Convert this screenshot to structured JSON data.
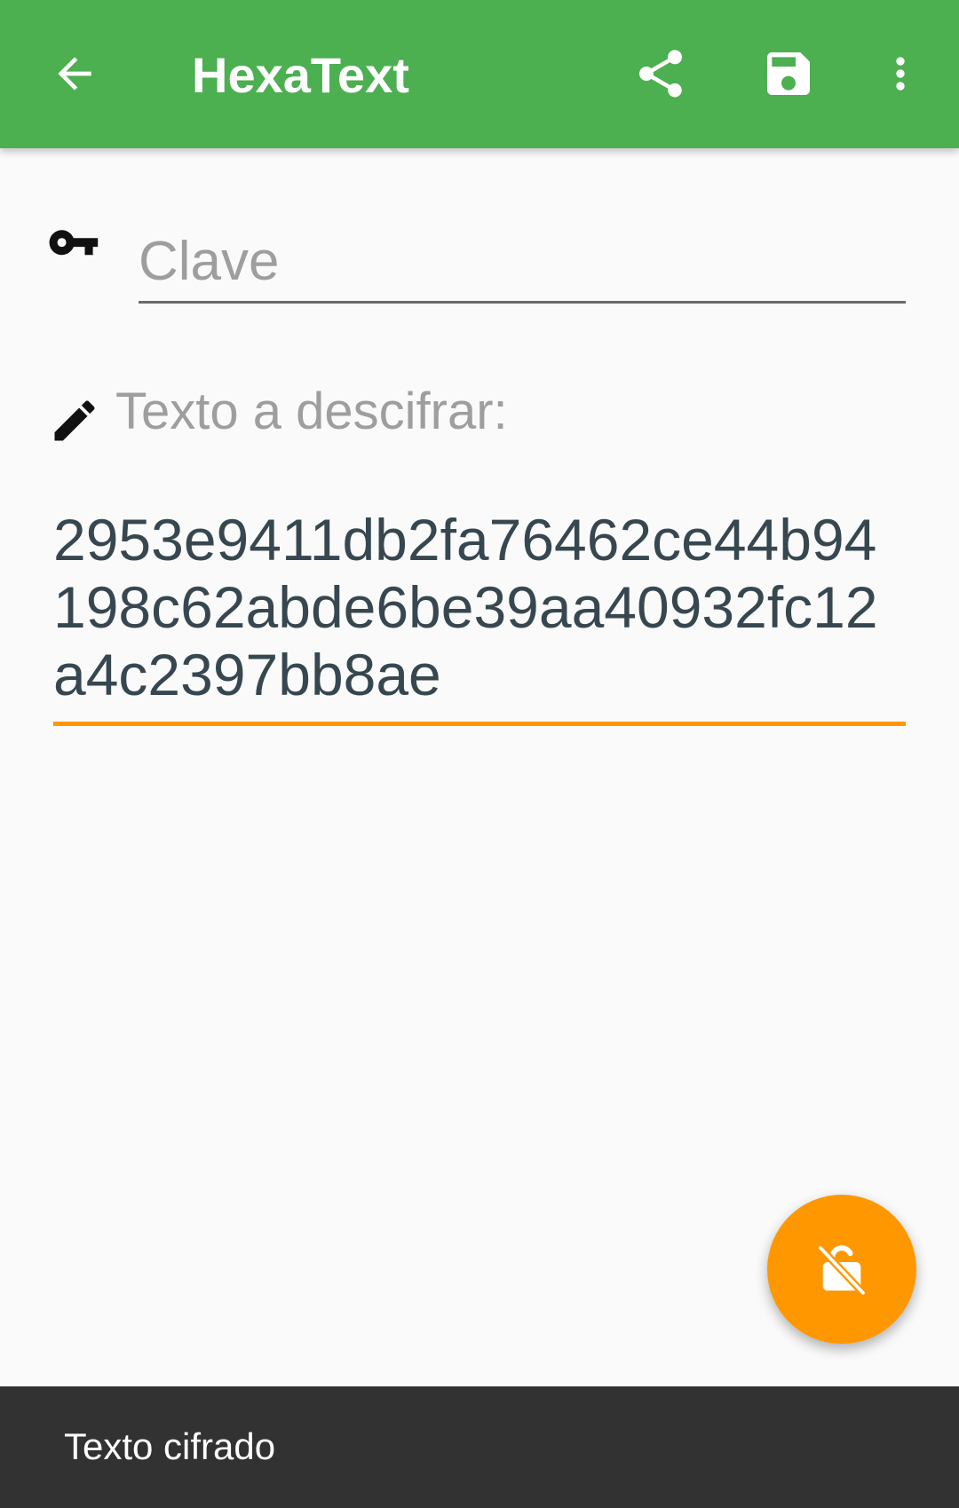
{
  "app_bar": {
    "title": "HexaText",
    "back_icon": "arrow-back-icon",
    "share_icon": "share-icon",
    "save_icon": "save-icon",
    "more_icon": "more-vert-icon",
    "color": "#4caf50"
  },
  "key_field": {
    "icon": "key-icon",
    "placeholder": "Clave",
    "value": ""
  },
  "cipher_field": {
    "icon": "pencil-icon",
    "label": "Texto a descifrar:",
    "value": "2953e9411db2fa76462ce44b94198c62abde6be39aa40932fc12a4c2397bb8ae",
    "underline_color": "#ff9800"
  },
  "fab": {
    "icon": "unlock-icon",
    "color": "#ff9800"
  },
  "snackbar": {
    "text": "Texto cifrado"
  }
}
